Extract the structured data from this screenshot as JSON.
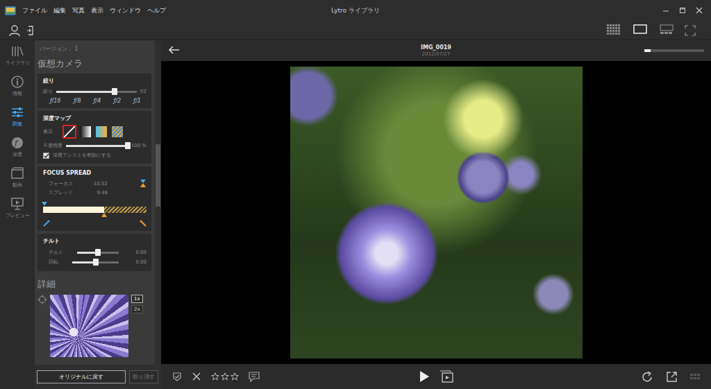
{
  "window": {
    "title": "Lytro ライブラリ"
  },
  "menu": [
    "ファイル",
    "編集",
    "写真",
    "表示",
    "ウィンドウ",
    "ヘルプ"
  ],
  "view_modes": [
    {
      "selected": false
    },
    {
      "selected": true
    },
    {
      "selected": false
    }
  ],
  "rail": [
    {
      "label": "ライブラリ",
      "selected": false
    },
    {
      "label": "情報",
      "selected": false
    },
    {
      "label": "調整",
      "selected": true
    },
    {
      "label": "深度",
      "selected": false
    },
    {
      "label": "動画",
      "selected": false
    },
    {
      "label": "プレビュー",
      "selected": false
    }
  ],
  "panel": {
    "version": "バージョン： 1",
    "title": "仮想カメラ",
    "aperture": {
      "title": "絞り",
      "label": "絞り",
      "value": "f/2",
      "level": 0.73,
      "ticks": [
        "ƒ/16",
        "ƒ/8",
        "ƒ/4",
        "ƒ/2",
        "ƒ/1"
      ]
    },
    "depth_map": {
      "title": "深度マップ",
      "show_label": "表示",
      "swatches": [
        {
          "kind": "none",
          "selected": true
        },
        {
          "kind": "gradient",
          "selected": false
        },
        {
          "kind": "color",
          "selected": false
        },
        {
          "kind": "hatch",
          "selected": false
        }
      ],
      "opacity_label": "不透明度",
      "opacity_level": 1,
      "opacity_reading": "100 %",
      "assist": {
        "label": "深度アシストを有効にする",
        "checked": true
      }
    },
    "focus_spread": {
      "title": "FOCUS SPREAD",
      "rows": [
        {
          "label": "フォーカス",
          "value": "-10.52"
        },
        {
          "label": "スプレッド",
          "value": "9.48"
        }
      ],
      "level": 0.59
    },
    "tilt": {
      "title": "チルト",
      "sliders": [
        {
          "label": "チルト",
          "level": 0.5,
          "reading": "0.00"
        },
        {
          "label": "回転",
          "level": 0.5,
          "reading": "0.00"
        }
      ]
    },
    "details": {
      "title": "詳細",
      "zoom": [
        {
          "label": "1x",
          "selected": true
        },
        {
          "label": "2x",
          "selected": false
        }
      ]
    },
    "buttons": [
      {
        "label": "オリジナルに戻す",
        "disabled": false
      },
      {
        "label": "取り消す",
        "disabled": true
      }
    ]
  },
  "photo": {
    "title": "IMG_0019",
    "date": "2012/07/27",
    "zoom_level": 0.1
  },
  "toolbar": {
    "stars": 0,
    "max_stars": 3
  }
}
